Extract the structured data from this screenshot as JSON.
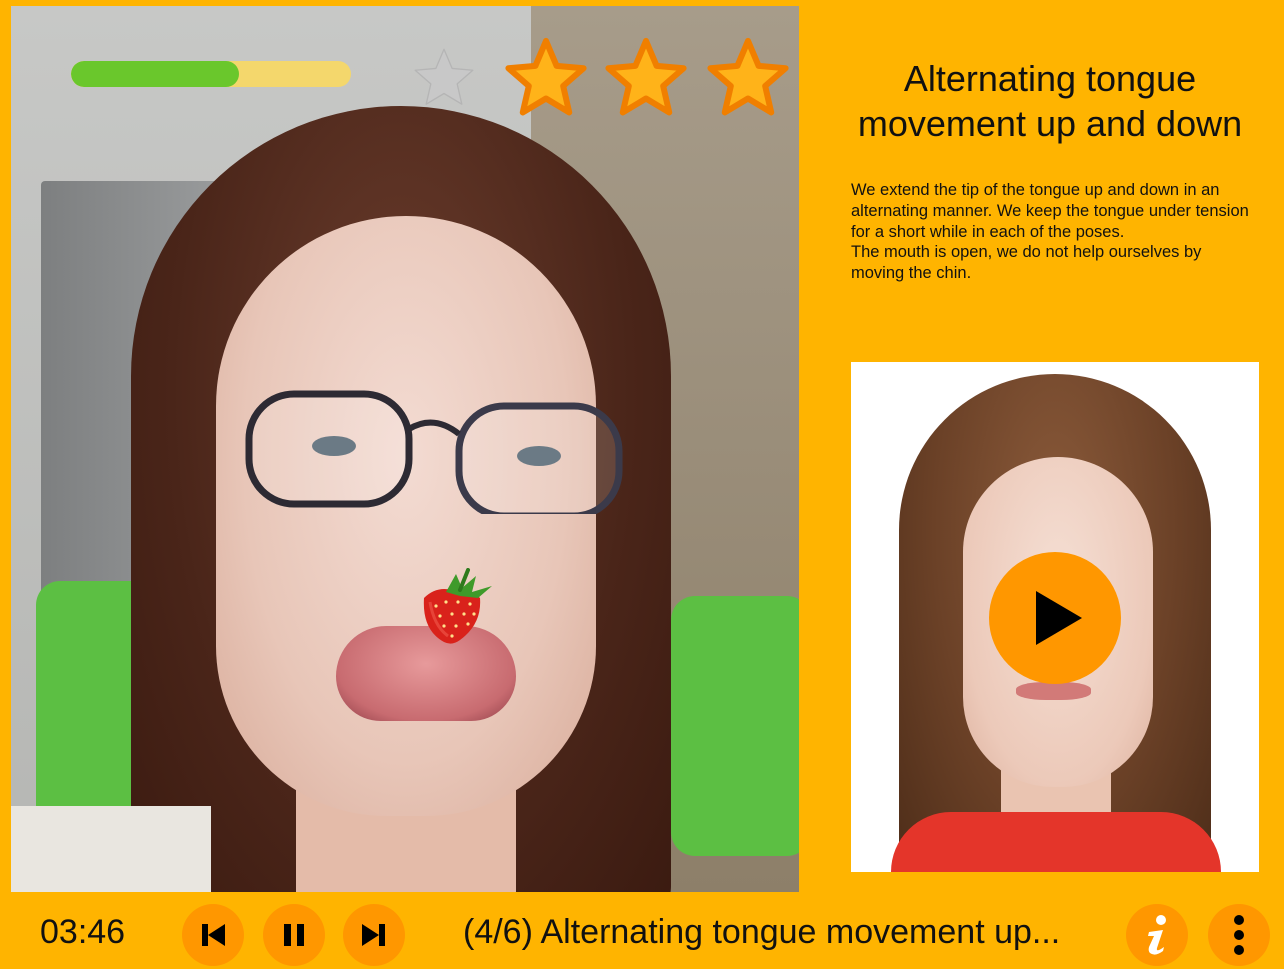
{
  "app": {
    "accent_color": "#FFB400",
    "button_color": "#FF9700"
  },
  "progress": {
    "fraction": 0.6
  },
  "rating": {
    "max": 4,
    "filled": 3,
    "filled_color": "#FFB319",
    "empty_color": "#C8C8C8"
  },
  "overlay": {
    "icon": "strawberry-icon"
  },
  "exercise": {
    "title": "Alternating tongue movement up and down",
    "description": [
      "We extend the tip of the tongue up and down in an alternating manner. We keep the tongue under tension for a short while in each of the poses.",
      "The mouth is open, we do not help ourselves by moving the chin."
    ],
    "demo_video": {
      "play_icon": "play-icon"
    }
  },
  "controls": {
    "timer": "03:46",
    "previous_icon": "skip-previous-icon",
    "pause_icon": "pause-icon",
    "next_icon": "skip-next-icon",
    "status_text": "(4/6) Alternating tongue movement up...",
    "info_icon": "info-icon",
    "menu_icon": "more-vertical-icon"
  }
}
